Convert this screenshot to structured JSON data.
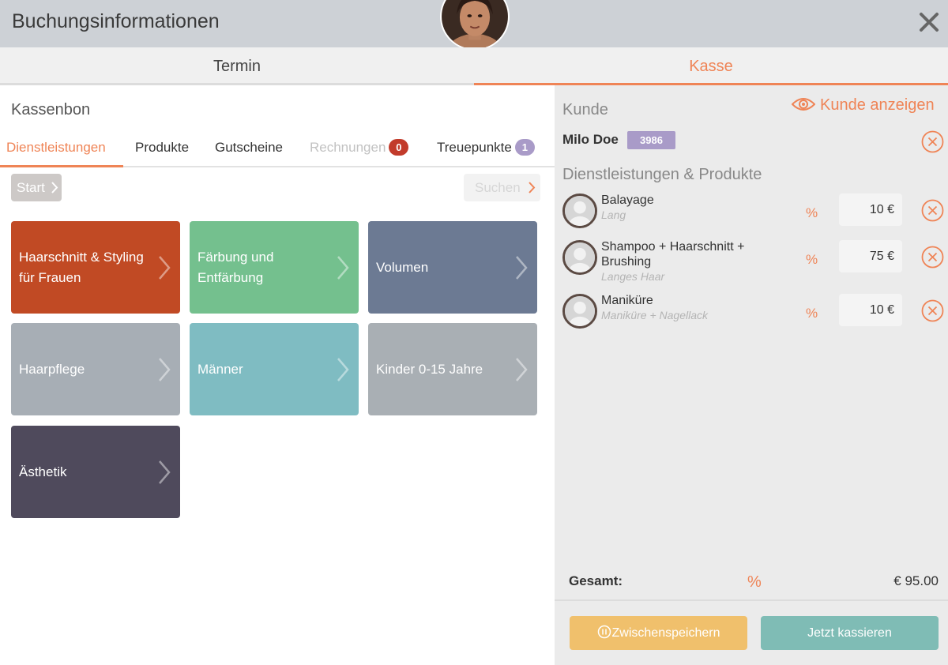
{
  "header": {
    "title": "Buchungsinformationen"
  },
  "top_tabs": {
    "termin": "Termin",
    "kasse": "Kasse"
  },
  "left": {
    "section_title": "Kassenbon",
    "sub_tabs": [
      {
        "label": "Dienstleistungen"
      },
      {
        "label": "Produkte"
      },
      {
        "label": "Gutscheine"
      },
      {
        "label": "Rechnungen",
        "badge": "0"
      },
      {
        "label": "Treuepunkte",
        "badge": "1"
      }
    ],
    "start_label": "Start",
    "search_label": "Suchen",
    "tiles": [
      {
        "label": "Haarschnitt & Styling für Frauen",
        "color": "#c14a24"
      },
      {
        "label": "Färbung und Entfärbung",
        "color": "#74c08e"
      },
      {
        "label": "Volumen",
        "color": "#6c7a93"
      },
      {
        "label": "Haarpflege",
        "color": "#a7aeb5"
      },
      {
        "label": "Männer",
        "color": "#7fbcc2"
      },
      {
        "label": "Kinder 0-15 Jahre",
        "color": "#a9afb4"
      },
      {
        "label": "Ästhetik",
        "color": "#4f4a5c"
      }
    ]
  },
  "right": {
    "kunde_label": "Kunde",
    "kunde_show": "Kunde anzeigen",
    "customer": {
      "name": "Milo Doe",
      "id": "3986"
    },
    "services_title": "Dienstleistungen & Produkte",
    "items": [
      {
        "name": "Balayage",
        "sub": "Lang",
        "pct": "%",
        "price": "10 €"
      },
      {
        "name": "Shampoo + Haarschnitt + Brushing",
        "sub": "Langes Haar",
        "pct": "%",
        "price": "75 €"
      },
      {
        "name": "Maniküre",
        "sub": "Maniküre + Nagellack",
        "pct": "%",
        "price": "10 €"
      }
    ],
    "total_label": "Gesamt:",
    "total_pct": "%",
    "total_value": "€ 95.00",
    "save_label": "Zwischenspeichern",
    "checkout_label": "Jetzt kassieren"
  },
  "colors": {
    "accent": "#ef8456",
    "header_bg": "#cdd1d6",
    "right_bg": "#ebebeb"
  }
}
